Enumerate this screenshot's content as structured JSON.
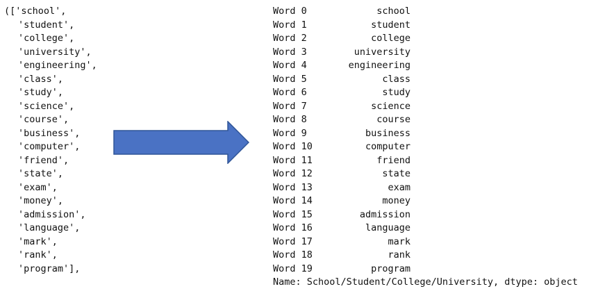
{
  "left": {
    "lines": [
      "(['school',",
      "'student',",
      "'college',",
      "'university',",
      "'engineering',",
      "'class',",
      "'study',",
      "'science',",
      "'course',",
      "'business',",
      "'computer',",
      "'friend',",
      "'state',",
      "'exam',",
      "'money',",
      "'admission',",
      "'language',",
      "'mark',",
      "'rank',",
      "'program'],"
    ]
  },
  "right": {
    "rows": [
      {
        "label": "Word 0",
        "value": "school"
      },
      {
        "label": "Word 1",
        "value": "student"
      },
      {
        "label": "Word 2",
        "value": "college"
      },
      {
        "label": "Word 3",
        "value": "university"
      },
      {
        "label": "Word 4",
        "value": "engineering"
      },
      {
        "label": "Word 5",
        "value": "class"
      },
      {
        "label": "Word 6",
        "value": "study"
      },
      {
        "label": "Word 7",
        "value": "science"
      },
      {
        "label": "Word 8",
        "value": "course"
      },
      {
        "label": "Word 9",
        "value": "business"
      },
      {
        "label": "Word 10",
        "value": "computer"
      },
      {
        "label": "Word 11",
        "value": "friend"
      },
      {
        "label": "Word 12",
        "value": "state"
      },
      {
        "label": "Word 13",
        "value": "exam"
      },
      {
        "label": "Word 14",
        "value": "money"
      },
      {
        "label": "Word 15",
        "value": "admission"
      },
      {
        "label": "Word 16",
        "value": "language"
      },
      {
        "label": "Word 17",
        "value": "mark"
      },
      {
        "label": "Word 18",
        "value": "rank"
      },
      {
        "label": "Word 19",
        "value": "program"
      }
    ],
    "footer": "Name: School/Student/College/University, dtype: object"
  },
  "arrow": {
    "icon": "right-arrow-icon",
    "fill": "#4a72c4",
    "stroke": "#2f5597"
  }
}
